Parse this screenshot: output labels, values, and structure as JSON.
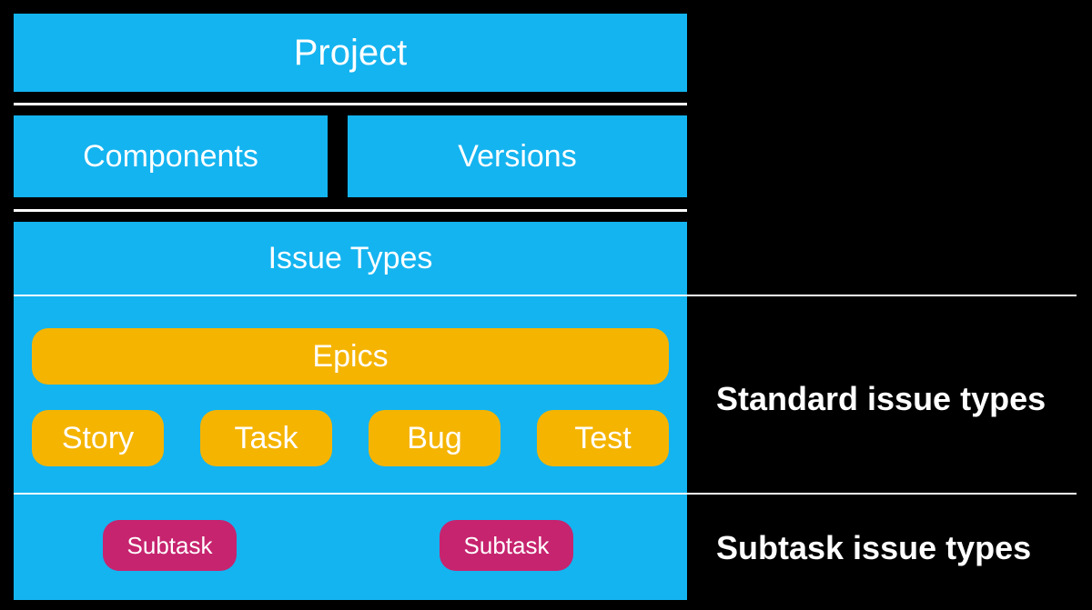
{
  "project": {
    "label": "Project"
  },
  "components": {
    "label": "Components"
  },
  "versions": {
    "label": "Versions"
  },
  "issue_types": {
    "label": "Issue Types"
  },
  "epics": {
    "label": "Epics"
  },
  "story": {
    "label": "Story"
  },
  "task": {
    "label": "Task"
  },
  "bug": {
    "label": "Bug"
  },
  "test": {
    "label": "Test"
  },
  "subtask1": {
    "label": "Subtask"
  },
  "subtask2": {
    "label": "Subtask"
  },
  "side_standard": "Standard issue types",
  "side_subtask": "Subtask issue types",
  "colors": {
    "bg": "#000000",
    "blue": "#14b4f0",
    "yellow": "#f5b400",
    "pink": "#c6246f",
    "white": "#ffffff"
  }
}
